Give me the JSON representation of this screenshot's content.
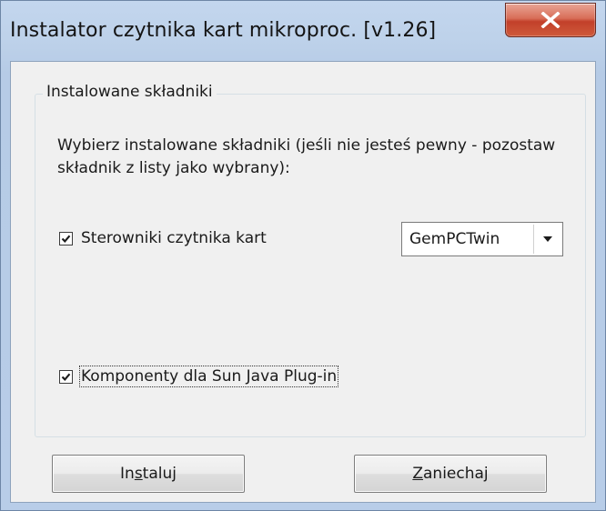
{
  "window": {
    "title": "Instalator czytnika kart mikroproc. [v1.26]",
    "close_icon": "close-icon"
  },
  "group": {
    "legend": "Instalowane składniki",
    "description": "Wybierz instalowane składniki (jeśli nie jesteś pewny - pozostaw składnik z listy jako wybrany):"
  },
  "components": [
    {
      "label": "Sterowniki czytnika kart",
      "checked": true
    },
    {
      "label": "Komponenty dla Sun Java Plug-in",
      "checked": true
    }
  ],
  "reader_select": {
    "selected": "GemPCTwin"
  },
  "buttons": {
    "install": {
      "before": "In",
      "mnemonic": "s",
      "after": "taluj"
    },
    "cancel": {
      "before": "",
      "mnemonic": "Z",
      "after": "aniechaj"
    }
  },
  "colors": {
    "close_button": "#c2402a",
    "titlebar": "#c3d6ee",
    "dialog_bg": "#f0f0f0"
  }
}
